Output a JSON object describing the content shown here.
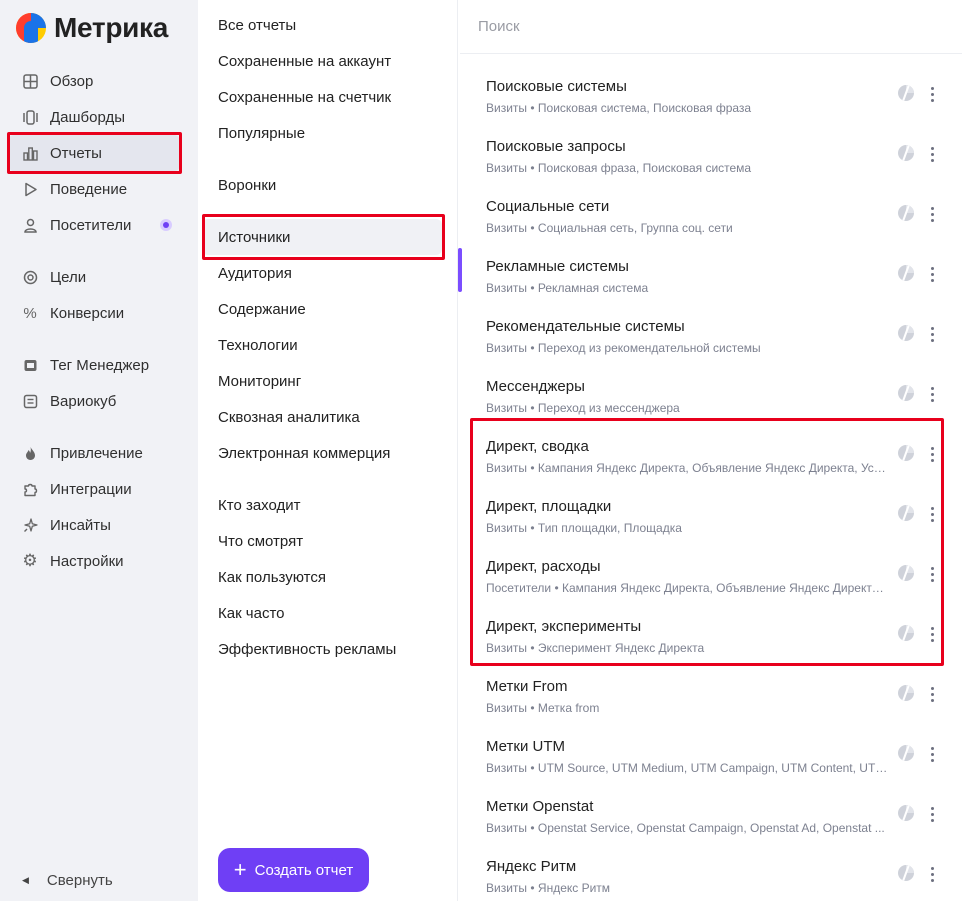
{
  "app": {
    "title": "Метрика"
  },
  "sidebar": {
    "items": [
      {
        "label": "Обзор",
        "icon": "grid-icon"
      },
      {
        "label": "Дашборды",
        "icon": "dashboard-icon"
      },
      {
        "label": "Отчеты",
        "icon": "bar-chart-icon"
      },
      {
        "label": "Поведение",
        "icon": "play-icon"
      },
      {
        "label": "Посетители",
        "icon": "user-icon"
      },
      {
        "label": "Цели",
        "icon": "target-icon"
      },
      {
        "label": "Конверсии",
        "icon": "percent-icon"
      },
      {
        "label": "Тег Менеджер",
        "icon": "tag-icon"
      },
      {
        "label": "Вариокуб",
        "icon": "cube-icon"
      },
      {
        "label": "Привлечение",
        "icon": "flame-icon"
      },
      {
        "label": "Интеграции",
        "icon": "puzzle-icon"
      },
      {
        "label": "Инсайты",
        "icon": "sparkle-icon"
      },
      {
        "label": "Настройки",
        "icon": "gear-icon"
      }
    ],
    "collapse_label": "Свернуть"
  },
  "reports_menu": {
    "items": [
      "Все отчеты",
      "Сохраненные на аккаунт",
      "Сохраненные на счетчик",
      "Популярные",
      "Воронки",
      "Источники",
      "Аудитория",
      "Содержание",
      "Технологии",
      "Мониторинг",
      "Сквозная аналитика",
      "Электронная коммерция",
      "Кто заходит",
      "Что смотрят",
      "Как пользуются",
      "Как часто",
      "Эффективность рекламы"
    ],
    "active": "Источники",
    "create_label": "Создать отчет"
  },
  "search": {
    "placeholder": "Поиск"
  },
  "reports": [
    {
      "title": "Поисковые системы",
      "subtitle": "Визиты • Поисковая система, Поисковая фраза"
    },
    {
      "title": "Поисковые запросы",
      "subtitle": "Визиты • Поисковая фраза, Поисковая система"
    },
    {
      "title": "Социальные сети",
      "subtitle": "Визиты • Социальная сеть, Группа соц. сети"
    },
    {
      "title": "Рекламные системы",
      "subtitle": "Визиты • Рекламная система"
    },
    {
      "title": "Рекомендательные системы",
      "subtitle": "Визиты • Переход из рекомендательной системы"
    },
    {
      "title": "Мессенджеры",
      "subtitle": "Визиты • Переход из мессенджера"
    },
    {
      "title": "Директ, сводка",
      "subtitle": "Визиты • Кампания Яндекс Директа, Объявление Яндекс Директа, Усл..."
    },
    {
      "title": "Директ, площадки",
      "subtitle": "Визиты • Тип площадки, Площадка"
    },
    {
      "title": "Директ, расходы",
      "subtitle": "Посетители • Кампания Яндекс Директа, Объявление Яндекс Директа,..."
    },
    {
      "title": "Директ, эксперименты",
      "subtitle": "Визиты • Эксперимент Яндекс Директа"
    },
    {
      "title": "Метки From",
      "subtitle": "Визиты • Метка from"
    },
    {
      "title": "Метки UTM",
      "subtitle": "Визиты • UTM Source, UTM Medium, UTM Campaign, UTM Content, UTM..."
    },
    {
      "title": "Метки Openstat",
      "subtitle": "Визиты • Openstat Service, Openstat Campaign, Openstat Ad, Openstat ..."
    },
    {
      "title": "Яндекс Ритм",
      "subtitle": "Визиты • Яндекс Ритм"
    }
  ],
  "colors": {
    "accent": "#6f3ff5",
    "highlight": "#e8001c",
    "sidebar_bg": "#f1f2f6"
  }
}
